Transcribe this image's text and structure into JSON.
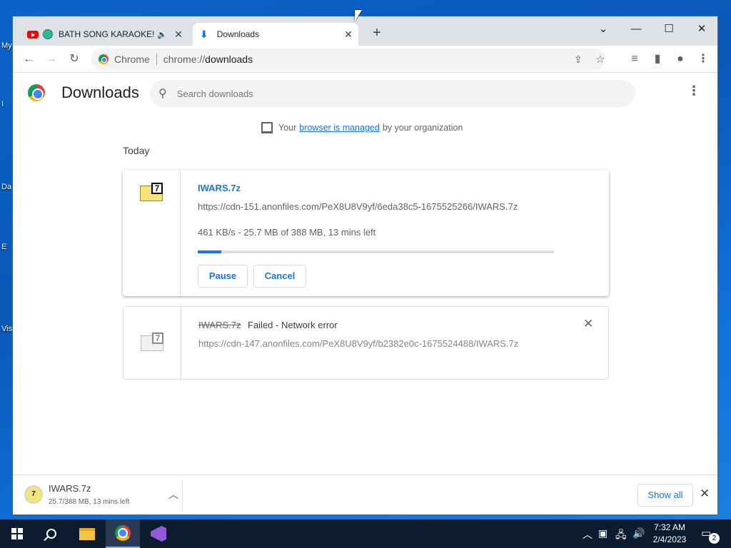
{
  "desktop": {
    "labels": [
      "My",
      "I",
      "Da",
      "E",
      "Vis"
    ]
  },
  "browser": {
    "tabs": [
      {
        "title": "BATH SONG KARAOKE!",
        "icon": "youtube-icon",
        "active": false
      },
      {
        "title": "Downloads",
        "icon": "download-icon",
        "active": true
      }
    ],
    "omnibox": {
      "chip": "Chrome",
      "url_scheme": "chrome://",
      "url_path": "downloads"
    }
  },
  "downloads_page": {
    "title": "Downloads",
    "search_placeholder": "Search downloads",
    "managed": {
      "prefix": "Your",
      "link": "browser is managed",
      "suffix": "by your organization"
    },
    "section": "Today",
    "items": [
      {
        "filename": "IWARS.7z",
        "url": "https://cdn-151.anonfiles.com/PeX8U8V9yf/6eda38c5-1675525266/IWARS.7z",
        "status": "461 KB/s - 25.7 MB of 388 MB, 13 mins left",
        "progress_fraction": 0.066,
        "buttons": [
          "Pause",
          "Cancel"
        ]
      },
      {
        "filename": "IWARS.7z",
        "failure": "Failed - Network error",
        "url": "https://cdn-147.anonfiles.com/PeX8U8V9yf/b2382e0c-1675524488/IWARS.7z"
      }
    ]
  },
  "shelf": {
    "filename": "IWARS.7z",
    "subtext": "25.7/388 MB, 13 mins left",
    "show_all": "Show all"
  },
  "taskbar": {
    "time": "7:32 AM",
    "date": "2/4/2023",
    "notification_count": "2"
  }
}
